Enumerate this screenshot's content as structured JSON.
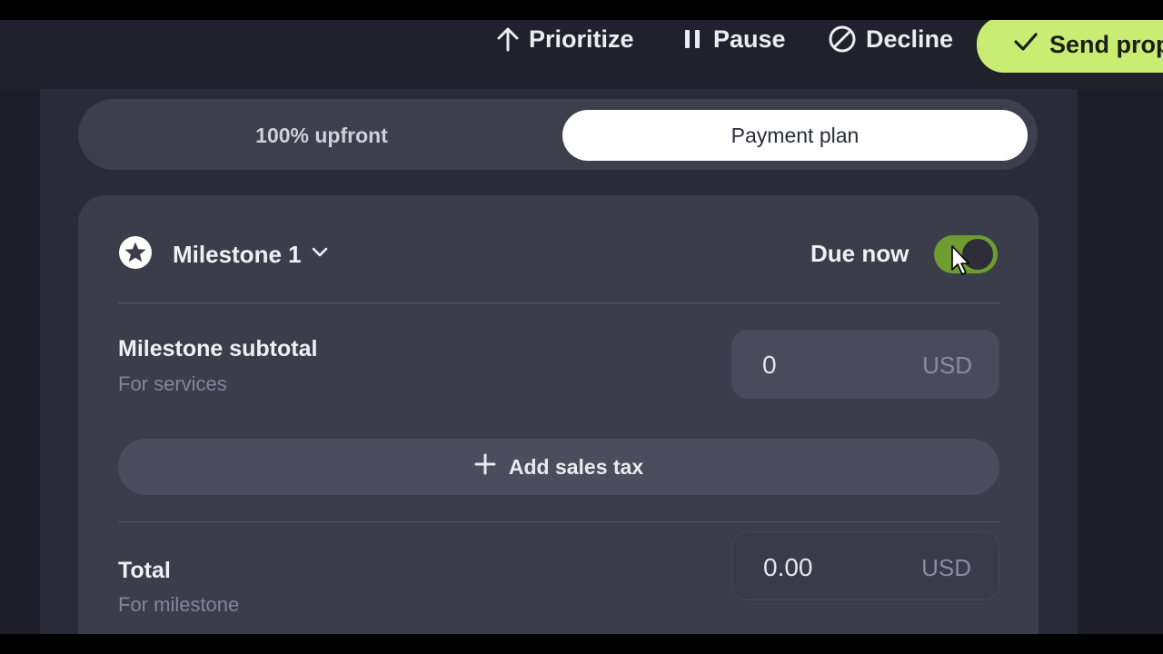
{
  "toolbar": {
    "prioritize": "Prioritize",
    "pause": "Pause",
    "decline": "Decline",
    "send": "Send prop"
  },
  "payment_mode": {
    "options": [
      "100% upfront",
      "Payment plan"
    ],
    "selected": "Payment plan"
  },
  "milestone": {
    "title": "Milestone 1",
    "due_label": "Due now",
    "due_now_enabled": true,
    "subtotal_label": "Milestone subtotal",
    "subtotal_sub": "For services",
    "subtotal_value": "0",
    "subtotal_currency": "USD",
    "add_tax_label": "Add sales tax",
    "total_label": "Total",
    "total_sub": "For milestone",
    "total_value": "0.00",
    "total_currency": "USD"
  },
  "colors": {
    "accent": "#c9ec73",
    "toggle_on": "#6e9c31",
    "background": "#23232f"
  }
}
